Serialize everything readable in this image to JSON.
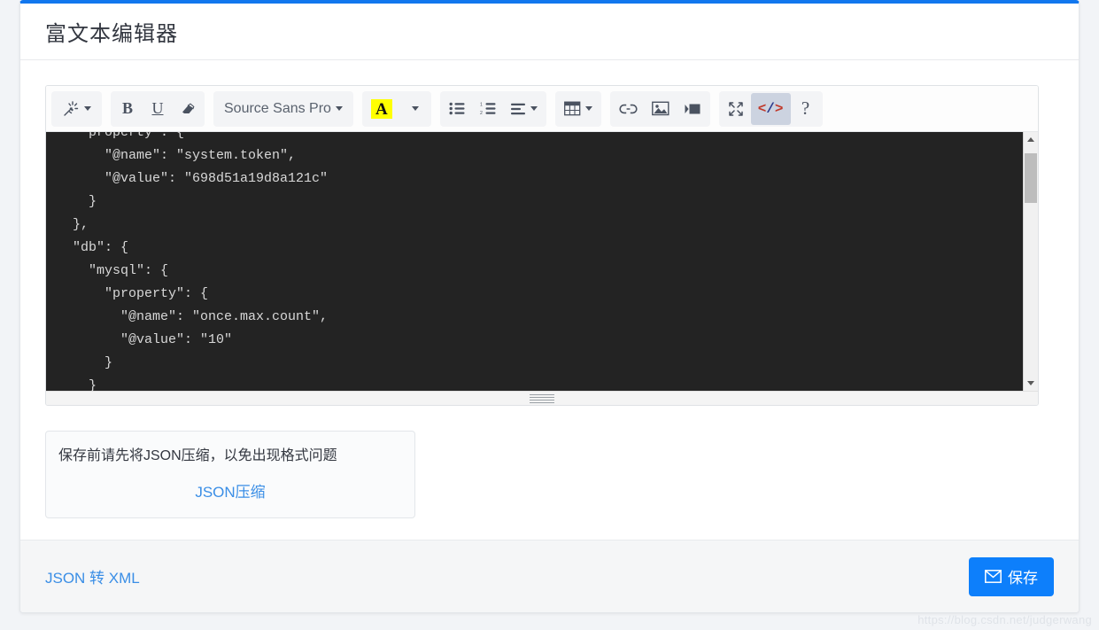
{
  "page": {
    "title": "富文本编辑器",
    "accent_color": "#1177ee",
    "watermark": "https://blog.csdn.net/judgerwang"
  },
  "toolbar": {
    "groups": [
      {
        "name": "style-group",
        "items": [
          {
            "name": "magic-wand-icon",
            "label": "",
            "icon": "magic-wand",
            "has_caret": true,
            "active": false
          }
        ]
      },
      {
        "name": "format-group",
        "items": [
          {
            "name": "bold-button",
            "label": "B",
            "icon": "bold",
            "has_caret": false,
            "active": false
          },
          {
            "name": "underline-button",
            "label": "U",
            "icon": "underline",
            "has_caret": false,
            "active": false
          },
          {
            "name": "eraser-button",
            "label": "",
            "icon": "eraser",
            "has_caret": false,
            "active": false
          }
        ]
      },
      {
        "name": "font-group",
        "items": [
          {
            "name": "font-family-select",
            "label": "Source Sans Pro",
            "icon": "text",
            "has_caret": true,
            "active": false
          }
        ]
      },
      {
        "name": "color-group",
        "items": [
          {
            "name": "text-color-button",
            "label": "A",
            "icon": "highlight-A",
            "has_caret": false,
            "active": false
          },
          {
            "name": "color-dropdown-button",
            "label": "",
            "icon": "caret-only",
            "has_caret": true,
            "active": false
          }
        ]
      },
      {
        "name": "list-group",
        "items": [
          {
            "name": "bullet-list-button",
            "label": "",
            "icon": "bullet-list",
            "has_caret": false,
            "active": false
          },
          {
            "name": "numbered-list-button",
            "label": "",
            "icon": "numbered-list",
            "has_caret": false,
            "active": false
          },
          {
            "name": "align-button",
            "label": "",
            "icon": "align-left",
            "has_caret": true,
            "active": false
          }
        ]
      },
      {
        "name": "table-group",
        "items": [
          {
            "name": "table-button",
            "label": "",
            "icon": "table",
            "has_caret": true,
            "active": false
          }
        ]
      },
      {
        "name": "insert-group",
        "items": [
          {
            "name": "link-button",
            "label": "",
            "icon": "link",
            "has_caret": false,
            "active": false
          },
          {
            "name": "image-button",
            "label": "",
            "icon": "image",
            "has_caret": false,
            "active": false
          },
          {
            "name": "video-button",
            "label": "",
            "icon": "video",
            "has_caret": false,
            "active": false
          }
        ]
      },
      {
        "name": "view-group",
        "items": [
          {
            "name": "fullscreen-button",
            "label": "",
            "icon": "fullscreen",
            "has_caret": false,
            "active": false
          },
          {
            "name": "code-view-button",
            "label": "</>",
            "icon": "code",
            "has_caret": false,
            "active": true
          },
          {
            "name": "help-button",
            "label": "?",
            "icon": "help",
            "has_caret": false,
            "active": false
          }
        ]
      }
    ]
  },
  "editor": {
    "code": "    property : {\n      \"@name\": \"system.token\",\n      \"@value\": \"698d51a19d8a121c\"\n    }\n  },\n  \"db\": {\n    \"mysql\": {\n      \"property\": {\n        \"@name\": \"once.max.count\",\n        \"@value\": \"10\"\n      }\n    }",
    "background_color": "#232323",
    "text_color": "#d8d8d8"
  },
  "hint": {
    "text": "保存前请先将JSON压缩，以免出现格式问题",
    "link_label": "JSON压缩"
  },
  "footer": {
    "convert_link": "JSON 转 XML",
    "save_label": "保存",
    "save_color": "#0d7ffb"
  }
}
